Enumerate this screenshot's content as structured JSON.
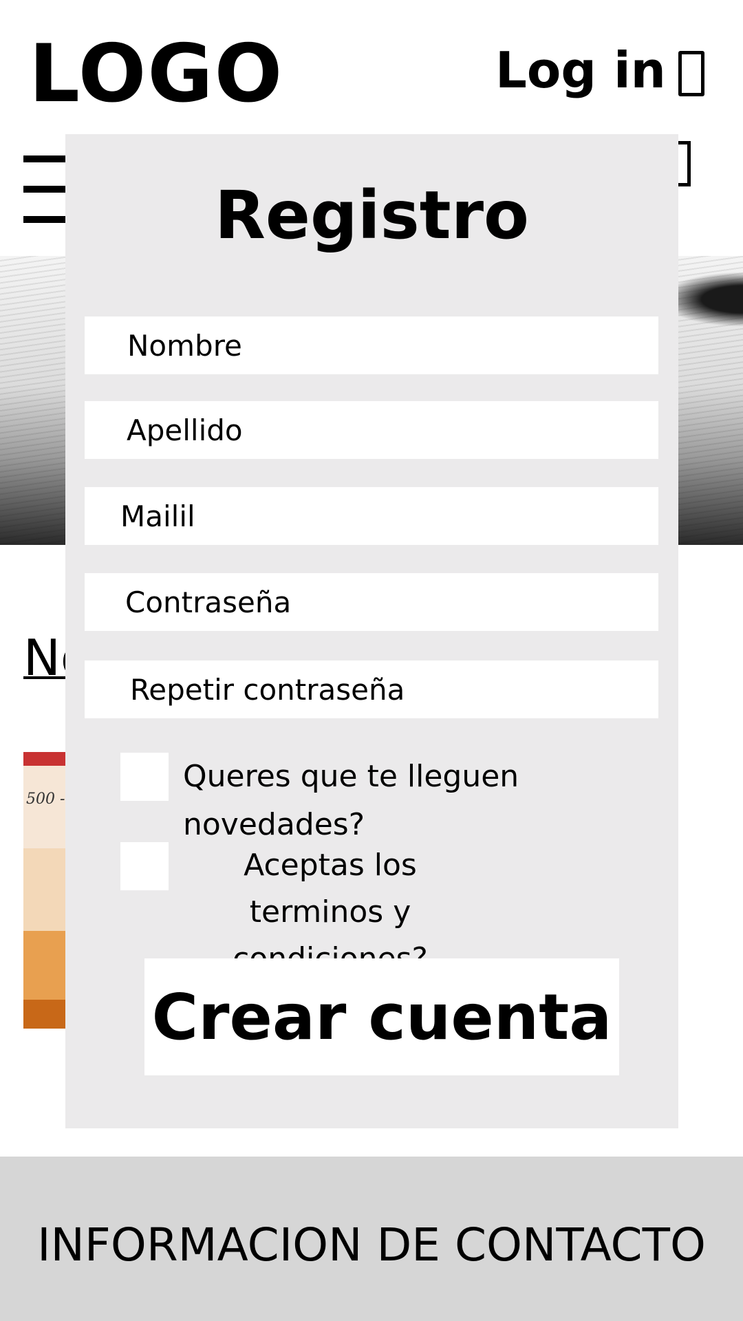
{
  "header": {
    "logo": "LOGO",
    "login_label": "Log in",
    "user_icon": "user-icon",
    "cart_icon": "cart-icon",
    "menu_icon": "hamburger-menu-icon"
  },
  "page": {
    "news_link_label": "No",
    "footer_text": "INFORMACION DE CONTACTO",
    "product_price_fragment": "500 -"
  },
  "modal": {
    "title": "Registro",
    "fields": {
      "nombre_placeholder": "Nombre",
      "apellido_placeholder": "Apellido",
      "mail_placeholder": "Mailil",
      "password_placeholder": "Contraseña",
      "repeat_password_placeholder": "Repetir contraseña"
    },
    "checkboxes": {
      "newsletter_label": "Queres que te lleguen novedades?",
      "terms_label_line1": "Aceptas los terminos y",
      "terms_label_line2": "condiciones?"
    },
    "submit_label": "Crear cuenta"
  },
  "colors": {
    "modal_bg": "#ebeaeb",
    "footer_bg": "#d6d6d6",
    "text": "#000000"
  }
}
